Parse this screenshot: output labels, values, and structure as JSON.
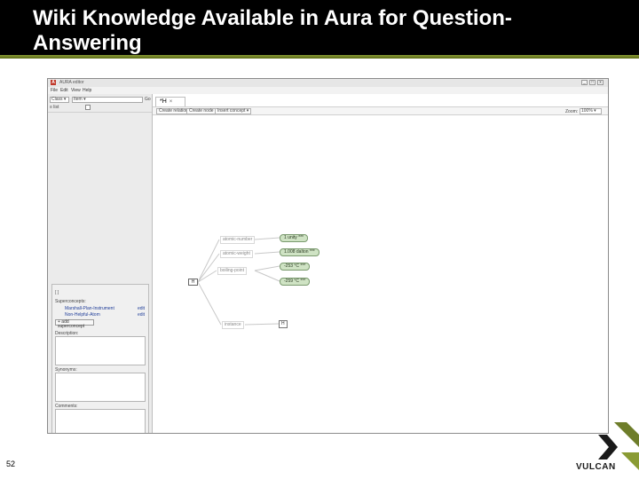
{
  "slide": {
    "title": "Wiki Knowledge Available in Aura for Question-Answering",
    "page_number": "52",
    "logo_text": "VULCAN"
  },
  "window": {
    "title": "AURA editor",
    "menu": [
      "File",
      "Edit",
      "View",
      "Help"
    ],
    "controls": [
      "_",
      "□",
      "x"
    ]
  },
  "left_panel": {
    "combo1": "Class ▾",
    "combo2": "Item ▾",
    "go_label": "Go",
    "row2_label": "≡ list",
    "lower": {
      "tab": "[ ]",
      "superconcepts_label": "Superconcepts:",
      "superconcepts": [
        {
          "name": "Marshall-Plan-Instrument",
          "edit": "edit"
        },
        {
          "name": "Non-Helpful-Atom",
          "edit": "edit"
        }
      ],
      "add_button": "+ add superconcept",
      "description_label": "Description:",
      "synonyms_label": "Synonyms:",
      "comments_label": "Comments:"
    }
  },
  "editor": {
    "tab_label": "*H",
    "toolbar": {
      "create_relation": "Create relation",
      "create_node": "Create node",
      "insert_concept": "Insert concept ▾",
      "zoom_label": "Zoom:",
      "zoom_value": "100% ▾"
    },
    "graph": {
      "center_node": "H",
      "relations": [
        {
          "label": "atomic-number",
          "value": "1 unity ***"
        },
        {
          "label": "atomic-weight",
          "value": "1.008 dalton ***"
        },
        {
          "label": "boiling-point",
          "value": "-253 °C ***"
        },
        {
          "label": "",
          "value": "-259 °C ***"
        },
        {
          "label": "instance",
          "value": "H"
        }
      ]
    }
  }
}
